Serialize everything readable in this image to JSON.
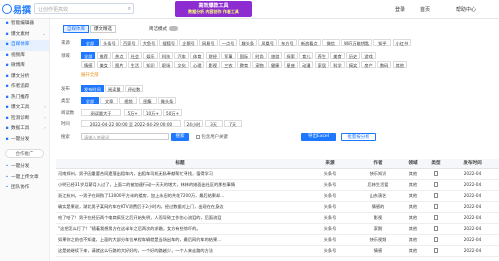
{
  "topbar": {
    "logo": "易撰",
    "search_placeholder": "让创作更高效",
    "banner_title": "高效爆款工具",
    "banner_sub": "数据分析 内容创作 作者工具",
    "links": [
      "登录",
      "首页",
      "帮助中心"
    ]
  },
  "sidebar": {
    "items": [
      {
        "label": "智能编辑器",
        "icon": "edit-icon"
      },
      {
        "label": "爆文素材",
        "icon": "fire-icon",
        "arrow": "⌄"
      },
      {
        "label": "自媒体库",
        "icon": "media-icon",
        "active": true
      },
      {
        "label": "视频库",
        "icon": "video-icon"
      },
      {
        "label": "微博库",
        "icon": "weibo-icon"
      },
      {
        "label": "爆文分析",
        "icon": "chart-icon"
      },
      {
        "label": "作者追踪",
        "icon": "track-icon"
      },
      {
        "label": "热门推荐",
        "icon": "hot-icon"
      },
      {
        "label": "爆文工具",
        "icon": "tool-icon",
        "arrow": "›"
      },
      {
        "label": "检测诊断",
        "icon": "check-icon",
        "arrow": "›"
      },
      {
        "label": "数据工具",
        "icon": "data-icon",
        "arrow": "›"
      },
      {
        "label": "一键分发",
        "icon": "share-icon"
      }
    ],
    "promo_button": "合作推广",
    "bottom_items": [
      {
        "label": "一键分发",
        "icon": "send-icon"
      },
      {
        "label": "一键上传文章",
        "icon": "upload-icon"
      },
      {
        "label": "团队协作",
        "icon": "team-icon"
      }
    ]
  },
  "main": {
    "tabs": [
      "自媒体库",
      "爆文精选"
    ],
    "toggle_label": "简洁模式",
    "platform_label": "来源",
    "platforms": [
      "全部",
      "头条号",
      "百家号",
      "大鱼号",
      "搜狐号",
      "企鹅号",
      "网易号",
      "一点号",
      "趣头条",
      "凤凰号",
      "东方号",
      "新浪看点",
      "微信",
      "WiFi万能钥匙",
      "知乎",
      "小红书"
    ],
    "category_label": "领域",
    "categories_row1": [
      "全部",
      "推荐",
      "热点",
      "社会",
      "娱乐",
      "科技",
      "汽车",
      "体育",
      "财经",
      "军事",
      "国际",
      "时尚",
      "旅游",
      "探索",
      "育儿",
      "养生",
      "美食",
      "历史",
      "游戏"
    ],
    "categories_row2": [
      "情感",
      "美女",
      "图片",
      "生活",
      "知识",
      "职场",
      "文化",
      "心理",
      "影视",
      "三农",
      "教育",
      "宠物",
      "健康",
      "星座",
      "动漫",
      "家居",
      "科学",
      "搞笑",
      "房产",
      "数码",
      "其他"
    ],
    "more_label": "展开全部",
    "publish_label": "发布",
    "publish_opts": [
      "发布时间",
      "阅读量",
      "评论数"
    ],
    "sort_label": "类型",
    "type_opts": [
      "全部",
      "文章",
      "视频",
      "图集",
      "微头条"
    ],
    "read_label": "阅读数",
    "read_placeholder": "阅读量大于",
    "read_opts": [
      "5万+",
      "10万+",
      "50万+"
    ],
    "time_label": "时间",
    "time_value": "2022-04-22 00:00  至  2022-04-29 00:00",
    "time_opts": [
      "24小时",
      "3天",
      "7天"
    ],
    "search_label": "搜索",
    "search_placeholder": "请输入关键词",
    "search_button": "搜索",
    "check_label": "包含用户关键",
    "export_button": "导出Excel",
    "batch_button": "批量按分析"
  },
  "table": {
    "headers": [
      "标题",
      "来源",
      "作者",
      "领域",
      "类型",
      "发布时间"
    ],
    "rows": [
      [
        "河南郑州，男子因重要合同遗落出租车内，出租车司机无私奉献帮忙寻找，值得学习",
        "头条号",
        "快乐知识",
        "其他",
        "doc",
        "2022-04"
      ],
      [
        "小明已经31岁月薪月入过了，上面二的被加速行动一天天的增大，林林的她面出社区的那些事情",
        "头条号",
        "后林生活爱",
        "其他",
        "doc",
        "2022-04"
      ],
      [
        "浙江杭州，一男子在网购了13000平方米的楼房，加上永旧的共花7200万，最后结果却...",
        "头条号",
        "山东演艺",
        "其他",
        "doc",
        "2022-04"
      ],
      [
        "确实是果说，湖北男子某网约车在KTV消费后于2小时内，经过数据对上门，出现在在身边",
        "头条号",
        "情感的",
        "其他",
        "doc",
        "2022-04"
      ],
      [
        "哈了哈了！男子在经历两个电商疯狂之后开始失明，人而导致工作伤心流泪的，后面流泪",
        "头条号",
        "影视",
        "其他",
        "doc",
        "2022-04"
      ],
      [
        "“这把怎么打了？”随着我想男方在这半年之后两次的求婚，女方有些惊吓的。",
        "头条号",
        "家鹅",
        "其他",
        "doc",
        "2022-04"
      ],
      [
        "如果你之前也不知道，上面的大部分车位单程车辆就是当场出车的，最后网约车的结果...",
        "头条号",
        "快乐视频",
        "其他",
        "doc",
        "2022-04"
      ],
      [
        "这是她继续下来，请就这么行路的大好好的，一个好的路越少，一个人来走路的方法",
        "头条号",
        "情感",
        "其他",
        "doc",
        "2022-04"
      ]
    ]
  }
}
